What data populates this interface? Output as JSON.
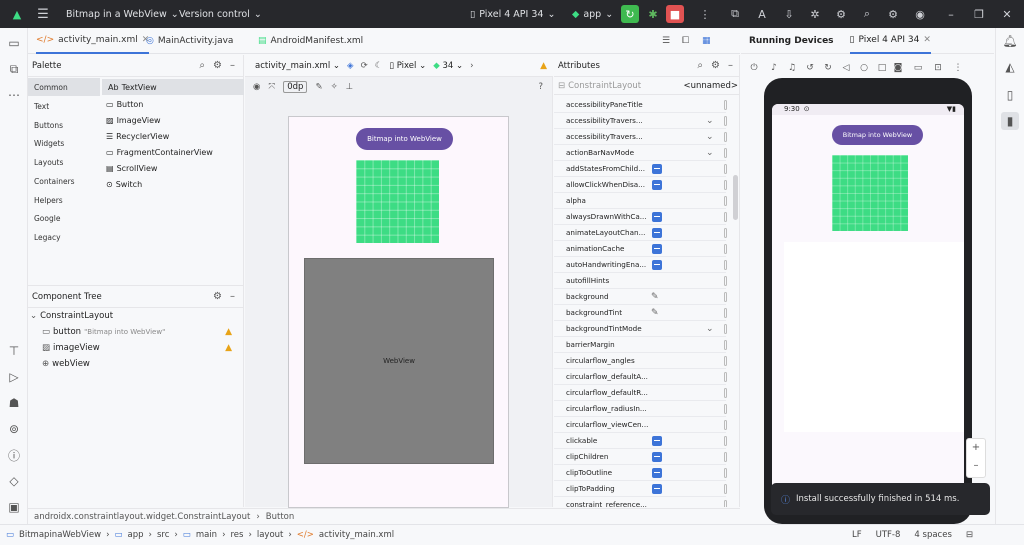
{
  "titlebar": {
    "project": "Bitmap in a WebView",
    "vcs": "Version control",
    "device": "Pixel 4 API 34",
    "module": "app"
  },
  "editor_tabs": [
    "activity_main.xml",
    "MainActivity.java",
    "AndroidManifest.xml"
  ],
  "palette": {
    "title": "Palette",
    "categories": [
      "Common",
      "Text",
      "Buttons",
      "Widgets",
      "Layouts",
      "Containers",
      "Helpers",
      "Google",
      "Legacy"
    ],
    "items": [
      {
        "icon": "Ab",
        "label": "TextView"
      },
      {
        "icon": "",
        "label": "Button"
      },
      {
        "icon": "",
        "label": "ImageView"
      },
      {
        "icon": "",
        "label": "RecyclerView"
      },
      {
        "icon": "",
        "label": "FragmentContainerView"
      },
      {
        "icon": "",
        "label": "ScrollView"
      },
      {
        "icon": "",
        "label": "Switch"
      }
    ]
  },
  "component_tree": {
    "title": "Component Tree",
    "root": "ConstraintLayout",
    "children": [
      {
        "label": "button",
        "hint": "\"Bitmap into WebView\"",
        "warning": true
      },
      {
        "label": "imageView",
        "hint": "",
        "warning": true
      },
      {
        "label": "webView",
        "hint": "",
        "warning": false
      }
    ]
  },
  "design_toolbar": {
    "file": "activity_main.xml",
    "device": "Pixel",
    "api": "34",
    "margin": "0dp"
  },
  "canvas": {
    "button_label": "Bitmap into WebView",
    "webview_label": "WebView"
  },
  "attributes": {
    "title": "Attributes",
    "layout": "ConstraintLayout",
    "id": "<unnamed>",
    "rows": [
      {
        "name": "accessibilityPaneTitle",
        "type": "text"
      },
      {
        "name": "accessibilityTravers...",
        "type": "dropdown"
      },
      {
        "name": "accessibilityTravers...",
        "type": "dropdown"
      },
      {
        "name": "actionBarNavMode",
        "type": "dropdown"
      },
      {
        "name": "addStatesFromChild...",
        "type": "check"
      },
      {
        "name": "allowClickWhenDisa...",
        "type": "check"
      },
      {
        "name": "alpha",
        "type": "text"
      },
      {
        "name": "alwaysDrawnWithCa...",
        "type": "check"
      },
      {
        "name": "animateLayoutChan...",
        "type": "check"
      },
      {
        "name": "animationCache",
        "type": "check"
      },
      {
        "name": "autoHandwritingEna...",
        "type": "check"
      },
      {
        "name": "autofillHints",
        "type": "text"
      },
      {
        "name": "background",
        "type": "pick"
      },
      {
        "name": "backgroundTint",
        "type": "pick"
      },
      {
        "name": "backgroundTintMode",
        "type": "dropdown"
      },
      {
        "name": "barrierMargin",
        "type": "text"
      },
      {
        "name": "circularflow_angles",
        "type": "text"
      },
      {
        "name": "circularflow_defaultA...",
        "type": "text"
      },
      {
        "name": "circularflow_defaultR...",
        "type": "text"
      },
      {
        "name": "circularflow_radiusIn...",
        "type": "text"
      },
      {
        "name": "circularflow_viewCen...",
        "type": "text"
      },
      {
        "name": "clickable",
        "type": "check"
      },
      {
        "name": "clipChildren",
        "type": "check"
      },
      {
        "name": "clipToOutline",
        "type": "check"
      },
      {
        "name": "clipToPadding",
        "type": "check"
      },
      {
        "name": "constraint_reference...",
        "type": "text"
      }
    ]
  },
  "running_devices": {
    "title": "Running Devices",
    "tab": "Pixel 4 API 34",
    "phone_time": "9:30",
    "button_label": "Bitmap into WebView",
    "toast": "Install successfully finished in 514 ms."
  },
  "breadcrumb": [
    "androidx.constraintlayout.widget.ConstraintLayout",
    "Button"
  ],
  "statusbar": {
    "path": [
      "BitmapinaWebView",
      "app",
      "src",
      "main",
      "res",
      "layout",
      "activity_main.xml"
    ],
    "line_ending": "LF",
    "encoding": "UTF-8",
    "indent": "4 spaces"
  },
  "colors": {
    "accent": "#3d74d8",
    "button_purple": "#6750a4",
    "image_green": "#3ddc84",
    "webview_gray": "#808080",
    "run_green": "#3fb950",
    "stop_red": "#e05252"
  }
}
